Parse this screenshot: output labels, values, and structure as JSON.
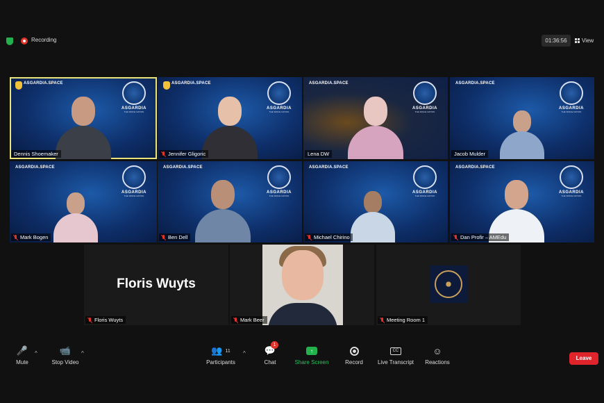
{
  "topbar": {
    "recording_label": "Recording",
    "timer": "01:36:56",
    "view_label": "View"
  },
  "brand": {
    "site": "ASGARDIA.SPACE",
    "word": "ASGARDIA",
    "tagline": "THE SPACE NATION"
  },
  "participants_grid": [
    {
      "name": "Dennis Shoemaker"
    },
    {
      "name": "Jennifer Gligoric"
    },
    {
      "name": "Lena DW"
    },
    {
      "name": "Jacob Mulder"
    },
    {
      "name": "Mark Bogen"
    },
    {
      "name": "Ben Dell"
    },
    {
      "name": "Michael Chirino"
    },
    {
      "name": "Dan Profir – AMEdu"
    },
    {
      "name": "Floris Wuyts",
      "big_name": "Floris Wuyts"
    },
    {
      "name": "Mark Beer"
    },
    {
      "name": "Meeting Room 1"
    }
  ],
  "toolbar": {
    "mute": "Mute",
    "stop_video": "Stop Video",
    "participants": "Participants",
    "participants_count": "11",
    "chat": "Chat",
    "chat_badge": "1",
    "share_screen": "Share Screen",
    "record": "Record",
    "live_transcript": "Live Transcript",
    "reactions": "Reactions",
    "leave": "Leave"
  },
  "colors": {
    "active_speaker_border": "#e9e37a",
    "share_green": "#22b14c",
    "leave_red": "#e0242b"
  }
}
